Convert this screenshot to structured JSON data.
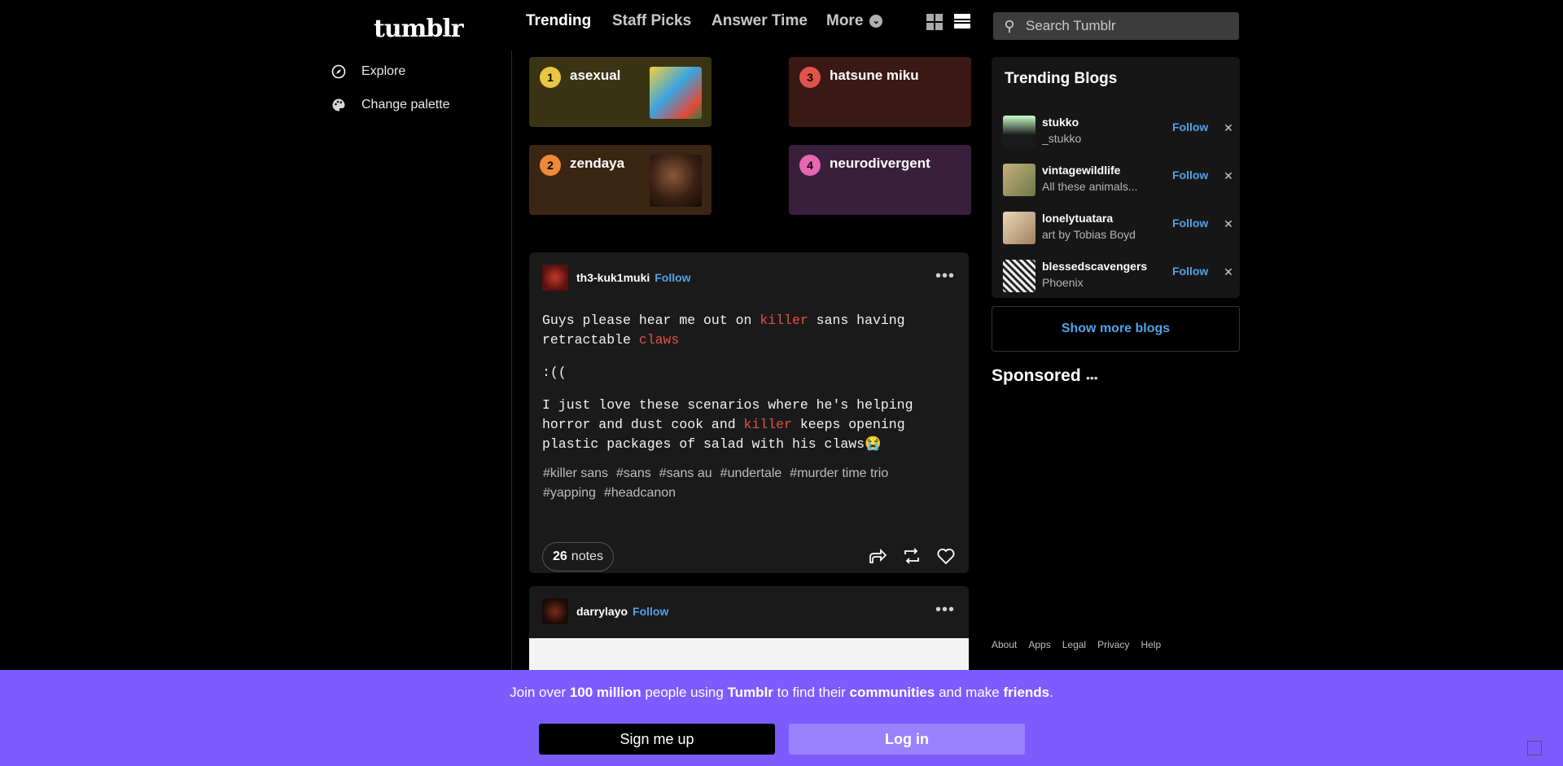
{
  "header": {
    "logo": "tumblr",
    "tabs": [
      {
        "label": "Trending"
      },
      {
        "label": "Staff Picks"
      },
      {
        "label": "Answer Time"
      },
      {
        "label": "More"
      }
    ],
    "search_placeholder": "Search Tumblr"
  },
  "sidebar": {
    "items": [
      {
        "label": "Explore",
        "icon": "compass-icon"
      },
      {
        "label": "Change palette",
        "icon": "palette-icon"
      }
    ]
  },
  "trending": [
    {
      "rank": "1",
      "name": "asexual",
      "color": "#e8c840",
      "bg": "#3a3414"
    },
    {
      "rank": "2",
      "name": "zendaya",
      "color": "#f0883a",
      "bg": "#3b2614"
    },
    {
      "rank": "3",
      "name": "hatsune miku",
      "color": "#e0534a",
      "bg": "#3a1814"
    },
    {
      "rank": "4",
      "name": "neurodivergent",
      "color": "#e866b4",
      "bg": "#3a1f3c"
    }
  ],
  "posts": [
    {
      "user": "th3-kuk1muki",
      "follow": "Follow",
      "body": {
        "p1_a": "Guys please hear me out on ",
        "p1_hl1": "killer",
        "p1_b": " sans having retractable ",
        "p1_hl2": "claws",
        "p2": ":((",
        "p3_a": "I just love these scenarios where he's helping horror and dust cook and ",
        "p3_hl": "killer",
        "p3_b": " keeps opening plastic packages of salad with his claws😭"
      },
      "tags": [
        "#killer sans",
        "#sans",
        "#sans au",
        "#undertale",
        "#murder time trio",
        "#yapping",
        "#headcanon"
      ],
      "notes_count": "26",
      "notes_label": "notes"
    },
    {
      "user": "darrylayo",
      "follow": "Follow"
    }
  ],
  "trending_blogs": {
    "title": "Trending Blogs",
    "blogs": [
      {
        "name": "stukko",
        "desc": "_stukko"
      },
      {
        "name": "vintagewildlife",
        "desc": "All these animals..."
      },
      {
        "name": "lonelytuatara",
        "desc": "art by Tobias Boyd"
      },
      {
        "name": "blessedscavengers",
        "desc": "Phoenix"
      }
    ],
    "follow_label": "Follow",
    "show_more": "Show more blogs"
  },
  "sponsored": {
    "title": "Sponsored"
  },
  "footer": {
    "links": [
      "About",
      "Apps",
      "Legal",
      "Privacy",
      "Help"
    ]
  },
  "banner": {
    "t1": "Join over ",
    "b1": "100 million",
    "t2": " people using ",
    "b2": "Tumblr",
    "t3": " to find their ",
    "b3": "communities",
    "t4": " and make ",
    "b4": "friends",
    "t5": ".",
    "signup": "Sign me up",
    "login": "Log in"
  },
  "colors": {
    "accent": "#4fa3e8",
    "banner": "#7c5cff",
    "highlight": "#e0534a"
  }
}
